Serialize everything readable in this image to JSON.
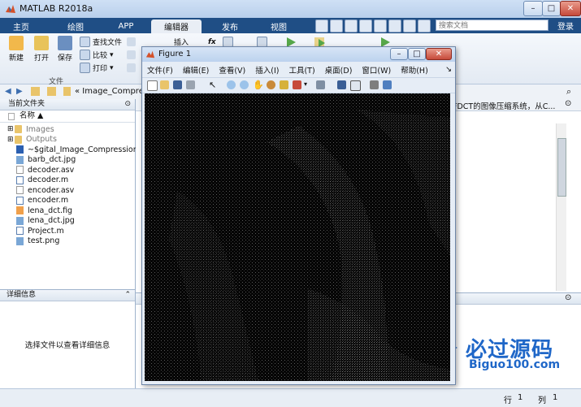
{
  "window": {
    "title": "MATLAB R2018a"
  },
  "tabs": [
    "主页",
    "绘图",
    "APP",
    "编辑器",
    "发布",
    "视图"
  ],
  "active_tab": "编辑器",
  "search": {
    "placeholder": "搜索文档"
  },
  "login_label": "登录",
  "ribbon": {
    "new_label": "新建",
    "open_label": "打开",
    "save_label": "保存",
    "find_files_label": "查找文件",
    "compare_label": "比较",
    "print_label": "打印",
    "insert_label": "插入",
    "fx_label": "fx",
    "group_file_label": "文件"
  },
  "address": {
    "path": "« Image_Compres"
  },
  "current_folder": {
    "header": "当前文件夹",
    "name_column": "名称",
    "items": [
      {
        "name": "Images",
        "type": "folder"
      },
      {
        "name": "Outputs",
        "type": "folder"
      },
      {
        "name": "~$gital_Image_Compression_...",
        "type": "doc"
      },
      {
        "name": "barb_dct.jpg",
        "type": "image"
      },
      {
        "name": "decoder.asv",
        "type": "asv"
      },
      {
        "name": "decoder.m",
        "type": "m"
      },
      {
        "name": "encoder.asv",
        "type": "asv"
      },
      {
        "name": "encoder.m",
        "type": "m"
      },
      {
        "name": "lena_dct.fig",
        "type": "fig"
      },
      {
        "name": "lena_dct.jpg",
        "type": "image"
      },
      {
        "name": "Project.m",
        "type": "m"
      },
      {
        "name": "test.png",
        "type": "image"
      }
    ]
  },
  "details": {
    "header": "详细信息",
    "empty_text": "选择文件以查看详细信息"
  },
  "editor_snippet": "FDCT的图像压缩系统，从C...",
  "statusbar": {
    "row_label": "行",
    "row_value": "1",
    "col_label": "列",
    "col_value": "1"
  },
  "figure": {
    "title": "Figure 1",
    "menu": [
      "文件(F)",
      "编辑(E)",
      "查看(V)",
      "插入(I)",
      "工具(T)",
      "桌面(D)",
      "窗口(W)",
      "帮助(H)"
    ]
  },
  "watermark": {
    "title": "必过源码",
    "subtitle": "Biguo100.com"
  },
  "colors": {
    "tabstrip": "#1f4e85",
    "canvas": "#070707",
    "watermark": "#1f67c8"
  }
}
